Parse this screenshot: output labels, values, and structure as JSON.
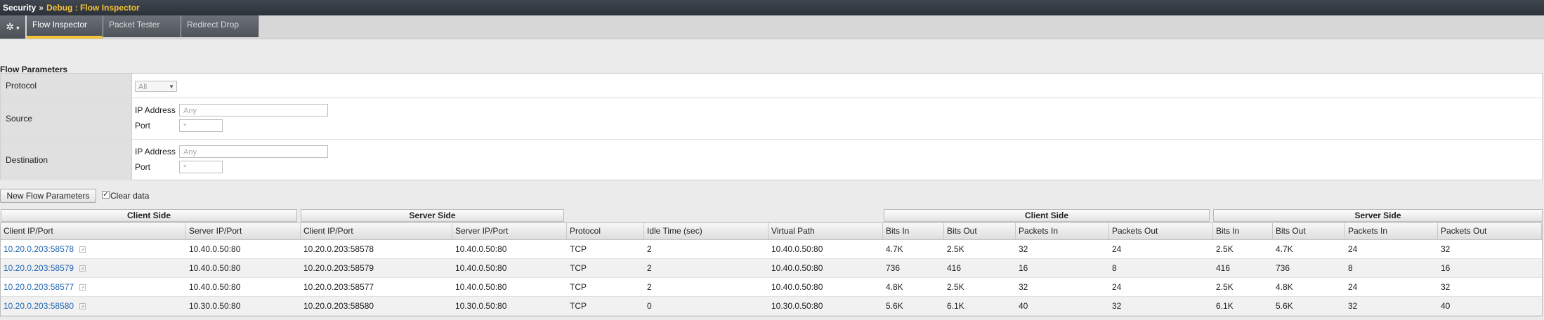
{
  "breadcrumb": {
    "section": "Security",
    "separator": "»",
    "page": "Debug : Flow Inspector"
  },
  "tabs": [
    {
      "label": "Flow Inspector",
      "active": true
    },
    {
      "label": "Packet Tester",
      "active": false
    },
    {
      "label": "Redirect Drop",
      "active": false
    }
  ],
  "gear": {
    "icon": "gear-icon",
    "glyph": "✲",
    "caret": "▾"
  },
  "flow_parameters": {
    "heading": "Flow Parameters",
    "protocol": {
      "label": "Protocol",
      "value": "All",
      "arrow": "▼"
    },
    "source": {
      "label": "Source",
      "ip_label": "IP Address",
      "ip_value": "Any",
      "port_label": "Port",
      "port_value": "*"
    },
    "destination": {
      "label": "Destination",
      "ip_label": "IP Address",
      "ip_value": "Any",
      "port_label": "Port",
      "port_value": "*"
    }
  },
  "controls": {
    "new_button": "New Flow Parameters",
    "clear_label": "Clear data",
    "clear_checked": true,
    "check_mark": "✓"
  },
  "groups": {
    "client_side": "Client Side",
    "server_side": "Server Side"
  },
  "columns": [
    "Client IP/Port",
    "Server IP/Port",
    "Client IP/Port",
    "Server IP/Port",
    "Protocol",
    "Idle Time (sec)",
    "Virtual Path",
    "Bits In",
    "Bits Out",
    "Packets In",
    "Packets Out",
    "Bits In",
    "Bits Out",
    "Packets In",
    "Packets Out"
  ],
  "rows": [
    [
      "10.20.0.203:58578",
      "10.40.0.50:80",
      "10.20.0.203:58578",
      "10.40.0.50:80",
      "TCP",
      "2",
      "10.40.0.50:80",
      "4.7K",
      "2.5K",
      "32",
      "24",
      "2.5K",
      "4.7K",
      "24",
      "32"
    ],
    [
      "10.20.0.203:58579",
      "10.40.0.50:80",
      "10.20.0.203:58579",
      "10.40.0.50:80",
      "TCP",
      "2",
      "10.40.0.50:80",
      "736",
      "416",
      "16",
      "8",
      "416",
      "736",
      "8",
      "16"
    ],
    [
      "10.20.0.203:58577",
      "10.40.0.50:80",
      "10.20.0.203:58577",
      "10.40.0.50:80",
      "TCP",
      "2",
      "10.40.0.50:80",
      "4.8K",
      "2.5K",
      "32",
      "24",
      "2.5K",
      "4.8K",
      "24",
      "32"
    ],
    [
      "10.20.0.203:58580",
      "10.30.0.50:80",
      "10.20.0.203:58580",
      "10.30.0.50:80",
      "TCP",
      "0",
      "10.30.0.50:80",
      "5.6K",
      "6.1K",
      "40",
      "32",
      "6.1K",
      "5.6K",
      "32",
      "40"
    ]
  ]
}
